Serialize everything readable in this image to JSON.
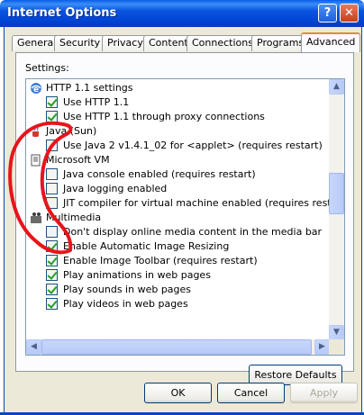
{
  "window": {
    "title": "Internet Options",
    "help_glyph": "?",
    "close_glyph": "✕"
  },
  "tabs": [
    "General",
    "Security",
    "Privacy",
    "Content",
    "Connections",
    "Programs",
    "Advanced"
  ],
  "active_tab": "Advanced",
  "settings_label": "Settings:",
  "list": {
    "http_group": "HTTP 1.1 settings",
    "http_items": [
      {
        "label": "Use HTTP 1.1",
        "checked": true
      },
      {
        "label": "Use HTTP 1.1 through proxy connections",
        "checked": true
      }
    ],
    "java_group": "Java (Sun)",
    "java_items": [
      {
        "label": "Use Java 2 v1.4.1_02 for <applet> (requires restart)",
        "checked": false
      }
    ],
    "vm_group": "Microsoft VM",
    "vm_items": [
      {
        "label": "Java console enabled (requires restart)",
        "checked": false
      },
      {
        "label": "Java logging enabled",
        "checked": false
      },
      {
        "label": "JIT compiler for virtual machine enabled (requires restart)",
        "checked": false
      }
    ],
    "mm_group": "Multimedia",
    "mm_items": [
      {
        "label": "Don't display online media content in the media bar",
        "checked": false
      },
      {
        "label": "Enable Automatic Image Resizing",
        "checked": true
      },
      {
        "label": "Enable Image Toolbar (requires restart)",
        "checked": true
      },
      {
        "label": "Play animations in web pages",
        "checked": true
      },
      {
        "label": "Play sounds in web pages",
        "checked": true
      },
      {
        "label": "Play videos in web pages",
        "checked": true
      }
    ]
  },
  "buttons": {
    "restore_defaults": "Restore Defaults",
    "ok": "OK",
    "cancel": "Cancel",
    "apply": "Apply"
  },
  "scroll_arrows": {
    "up": "▲",
    "down": "▼",
    "left": "◀",
    "right": "▶"
  },
  "colors": {
    "annotation": "#e8141a",
    "titlebar": "#0a54e0",
    "check": "#21a121"
  }
}
